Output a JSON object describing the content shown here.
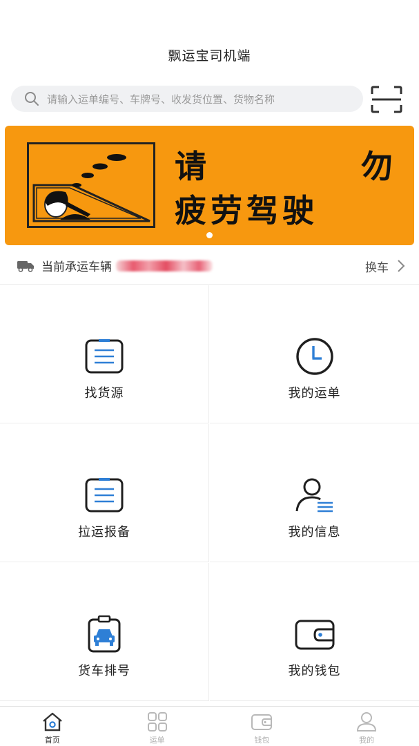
{
  "header": {
    "title": "飘运宝司机端"
  },
  "search": {
    "placeholder": "请输入运单编号、车牌号、收发货位置、货物名称"
  },
  "banner": {
    "line1_left": "请",
    "line1_right": "勿",
    "line2": "疲劳驾驶"
  },
  "vehicle": {
    "label": "当前承运车辆",
    "switch_label": "换车"
  },
  "menu": [
    {
      "label": "找货源",
      "icon": "clipboard-list-icon"
    },
    {
      "label": "我的运单",
      "icon": "clock-icon"
    },
    {
      "label": "拉运报备",
      "icon": "clipboard-list-icon"
    },
    {
      "label": "我的信息",
      "icon": "user-info-icon"
    },
    {
      "label": "货车排号",
      "icon": "truck-queue-icon"
    },
    {
      "label": "我的钱包",
      "icon": "wallet-icon"
    }
  ],
  "tabbar": {
    "items": [
      {
        "label": "首页",
        "icon": "home-icon",
        "active": true
      },
      {
        "label": "运单",
        "icon": "grid-icon",
        "active": false
      },
      {
        "label": "钱包",
        "icon": "wallet-icon",
        "active": false
      },
      {
        "label": "我的",
        "icon": "user-icon",
        "active": false
      }
    ]
  },
  "colors": {
    "banner": "#f7980f",
    "accent_blue": "#2e7fd6",
    "icon_dark": "#1f1f1f"
  }
}
